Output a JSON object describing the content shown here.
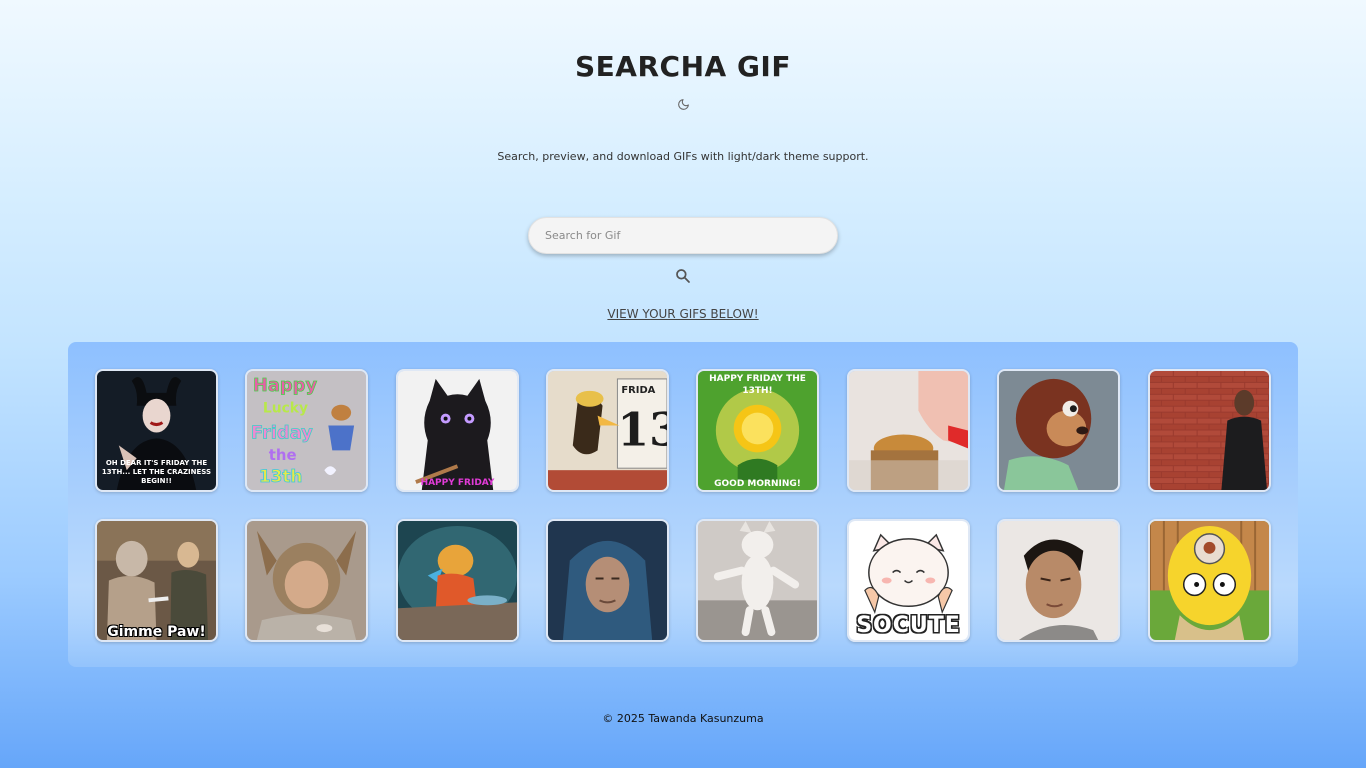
{
  "header": {
    "title": "SEARCHA GIF",
    "theme_icon": "moon-icon",
    "subtitle": "Search, preview, and download GIFs with light/dark theme support."
  },
  "search": {
    "placeholder": "Search for Gif",
    "value": "",
    "button_icon": "search-icon"
  },
  "view_link": "VIEW YOUR GIFS BELOW!",
  "gifs": [
    {
      "description": "maleficent-friday-13th",
      "caption": "OH DEAR IT'S FRIDAY THE 13TH... LET THE CRAZINESS BEGIN!!"
    },
    {
      "description": "happy-lucky-friday-13th",
      "caption": "Happy Lucky Friday the 13th"
    },
    {
      "description": "black-cat-happy-friday",
      "caption": "HAPPY FRIDAY"
    },
    {
      "description": "cartoon-bird-calendar-13",
      "caption": "FRIDA 13"
    },
    {
      "description": "sun-happy-friday-13th",
      "caption_top": "HAPPY FRIDAY THE 13TH!",
      "caption_bottom": "GOOD MORNING!"
    },
    {
      "description": "cat-cupcake-pat"
    },
    {
      "description": "monkey-puppet-side-eye"
    },
    {
      "description": "man-brick-wall"
    },
    {
      "description": "gimme-paw",
      "caption": "Gimme Paw!"
    },
    {
      "description": "furry-costume-man"
    },
    {
      "description": "winnie-the-pooh-eating"
    },
    {
      "description": "hooded-man-rain"
    },
    {
      "description": "dancing-white-cat"
    },
    {
      "description": "socute-cat-sticker",
      "caption": "SOCUTE"
    },
    {
      "description": "man-meme-face"
    },
    {
      "description": "homer-simpson-monkey-brain"
    }
  ],
  "footer": "© 2025 Tawanda Kasunzuma",
  "colors": {
    "background_top": "#f0f9ff",
    "background_bottom": "#66a6f9",
    "gallery_panel": "#8ec0ff",
    "search_field": "#f4f4f4"
  }
}
